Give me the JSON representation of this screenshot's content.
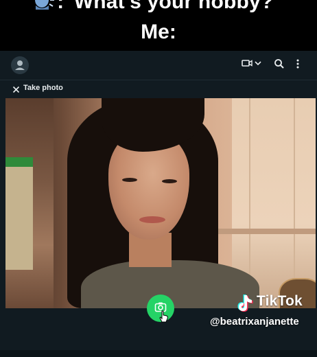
{
  "caption": {
    "line1": ":\"What's your hobby?\"",
    "line2": "Me:",
    "speaker_icon": "speaking-head-icon"
  },
  "topbar": {
    "avatar_icon": "user-avatar-icon",
    "icons": [
      "video-icon",
      "chevron-down-icon",
      "search-icon",
      "menu-dots-icon"
    ]
  },
  "take_photo": {
    "label": "Take photo",
    "close_icon": "close-icon"
  },
  "shutter": {
    "icon": "camera-icon",
    "color": "#25d366"
  },
  "watermark": {
    "brand": "TikTok",
    "handle": "@beatrixanjanette"
  },
  "colors": {
    "app_bg": "#111b21",
    "text": "#e9edef",
    "accent": "#25d366"
  }
}
